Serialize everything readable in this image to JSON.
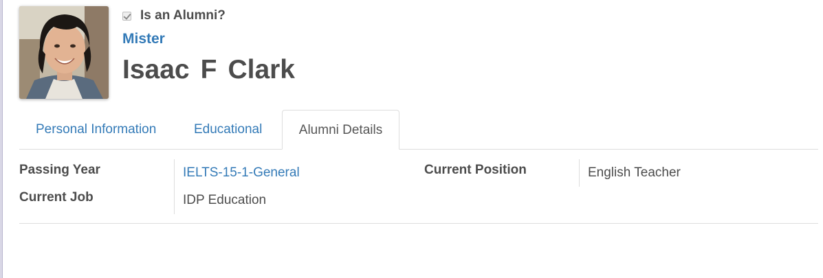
{
  "header": {
    "is_alumni_checked": true,
    "is_alumni_label": "Is an Alumni?",
    "title": "Mister",
    "name": {
      "first": "Isaac",
      "middle": "F",
      "last": "Clark"
    }
  },
  "tabs": [
    {
      "label": "Personal Information",
      "active": false
    },
    {
      "label": "Educational",
      "active": false
    },
    {
      "label": "Alumni Details",
      "active": true
    }
  ],
  "alumni_details": {
    "passing_year_label": "Passing Year",
    "passing_year_value": "IELTS-15-1-General",
    "current_position_label": "Current Position",
    "current_position_value": "English Teacher",
    "current_job_label": "Current Job",
    "current_job_value": "IDP Education"
  },
  "colors": {
    "link": "#337ab7",
    "text": "#4c4c4c",
    "border": "#dddddd"
  }
}
